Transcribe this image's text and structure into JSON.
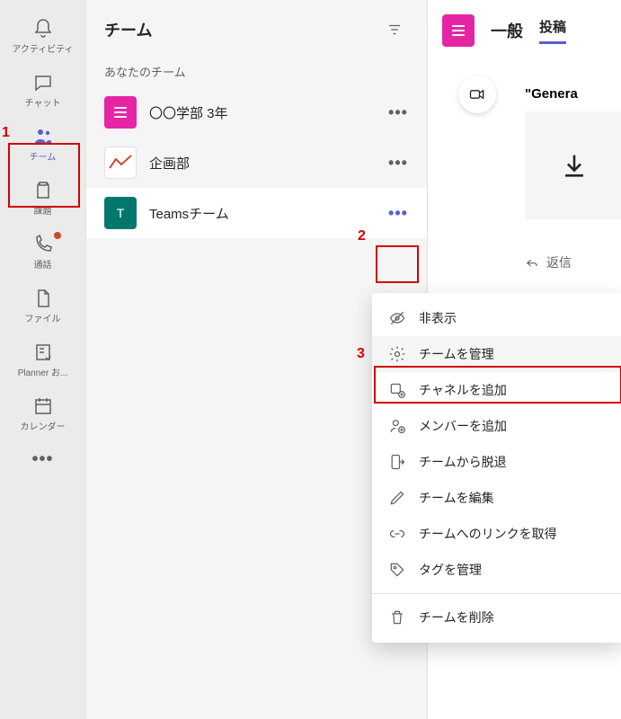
{
  "rail": {
    "items": [
      {
        "label": "アクティビティ",
        "icon": "bell"
      },
      {
        "label": "チャット",
        "icon": "chat"
      },
      {
        "label": "チーム",
        "icon": "teams",
        "active": true
      },
      {
        "label": "課題",
        "icon": "assignments"
      },
      {
        "label": "通話",
        "icon": "calls",
        "badge": true
      },
      {
        "label": "ファイル",
        "icon": "files"
      },
      {
        "label": "Planner お...",
        "icon": "planner"
      },
      {
        "label": "カレンダー",
        "icon": "calendar"
      }
    ]
  },
  "panel": {
    "title": "チーム",
    "section_label": "あなたのチーム",
    "teams": [
      {
        "name": "〇〇学部 3年",
        "avatar_color": "magenta"
      },
      {
        "name": "企画部",
        "avatar_color": "white"
      },
      {
        "name": "Teamsチーム",
        "avatar_color": "teal",
        "initial": "T",
        "selected": true
      }
    ]
  },
  "content": {
    "channel_title": "一般",
    "tab_label": "投稿",
    "general_text": "\"Genera",
    "reply_label": "返信"
  },
  "context_menu": {
    "items": [
      {
        "label": "非表示",
        "icon": "eye-off"
      },
      {
        "label": "チームを管理",
        "icon": "gear",
        "hover": true
      },
      {
        "label": "チャネルを追加",
        "icon": "channel-add"
      },
      {
        "label": "メンバーを追加",
        "icon": "member-add"
      },
      {
        "label": "チームから脱退",
        "icon": "leave"
      },
      {
        "label": "チームを編集",
        "icon": "edit"
      },
      {
        "label": "チームへのリンクを取得",
        "icon": "link"
      },
      {
        "label": "タグを管理",
        "icon": "tag"
      },
      {
        "label": "チームを削除",
        "icon": "trash",
        "sep_before": true
      }
    ]
  },
  "annotations": {
    "n1": "1",
    "n2": "2",
    "n3": "3"
  }
}
